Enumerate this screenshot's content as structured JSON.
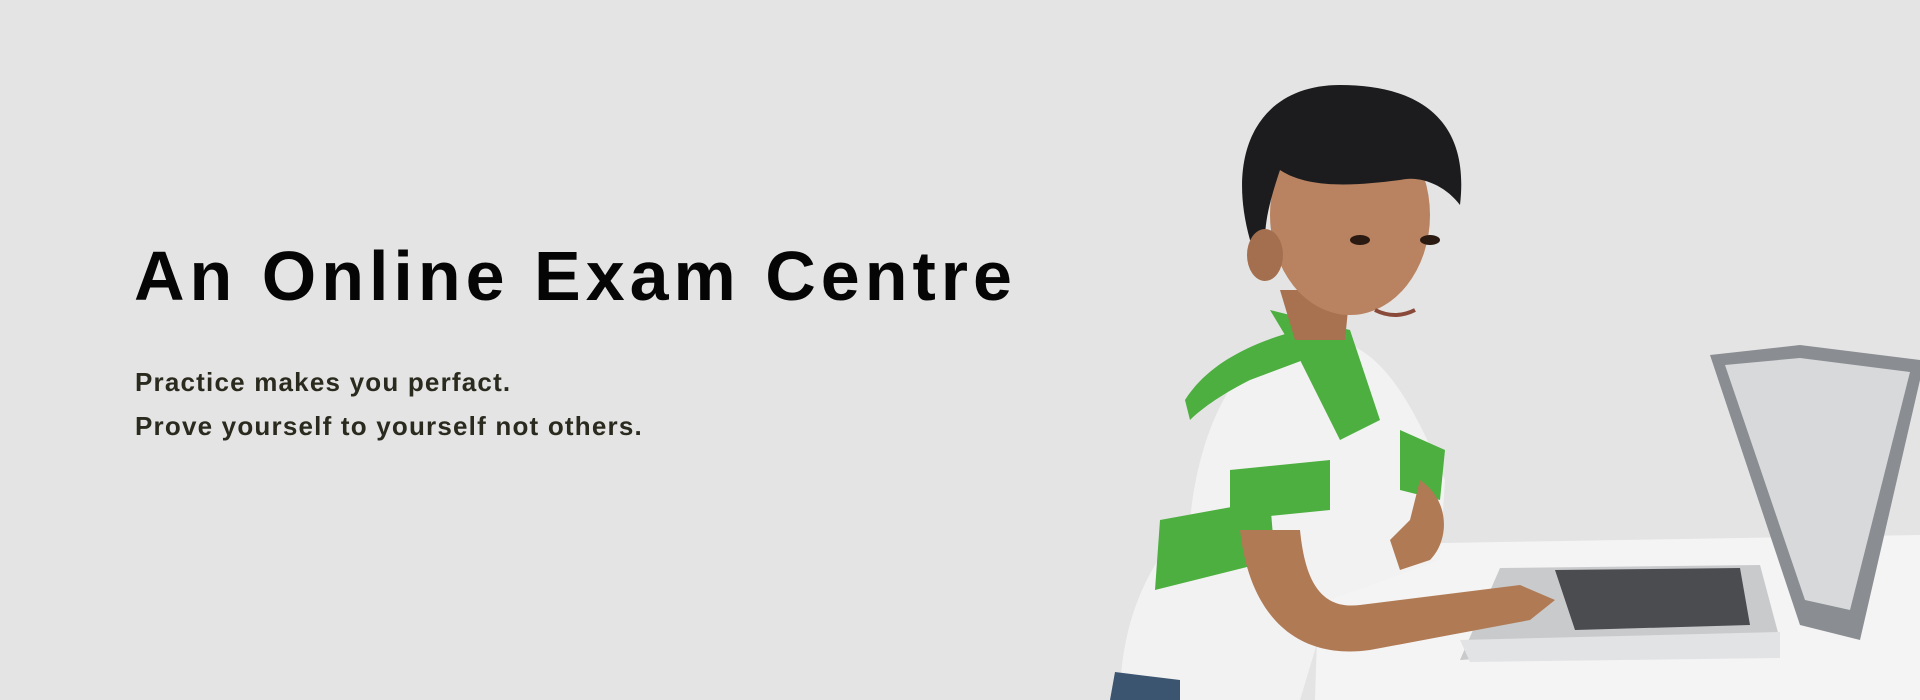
{
  "hero": {
    "title": "An Online Exam Centre",
    "taglines": [
      "Practice makes you perfact.",
      "Prove yourself to yourself not others."
    ]
  },
  "image": {
    "subject": "boy-with-laptop-photo"
  },
  "colors": {
    "background": "#e4e4e4",
    "title": "#050505",
    "tagline": "#2a2a1e",
    "shirt_green": "#4caf3f"
  }
}
